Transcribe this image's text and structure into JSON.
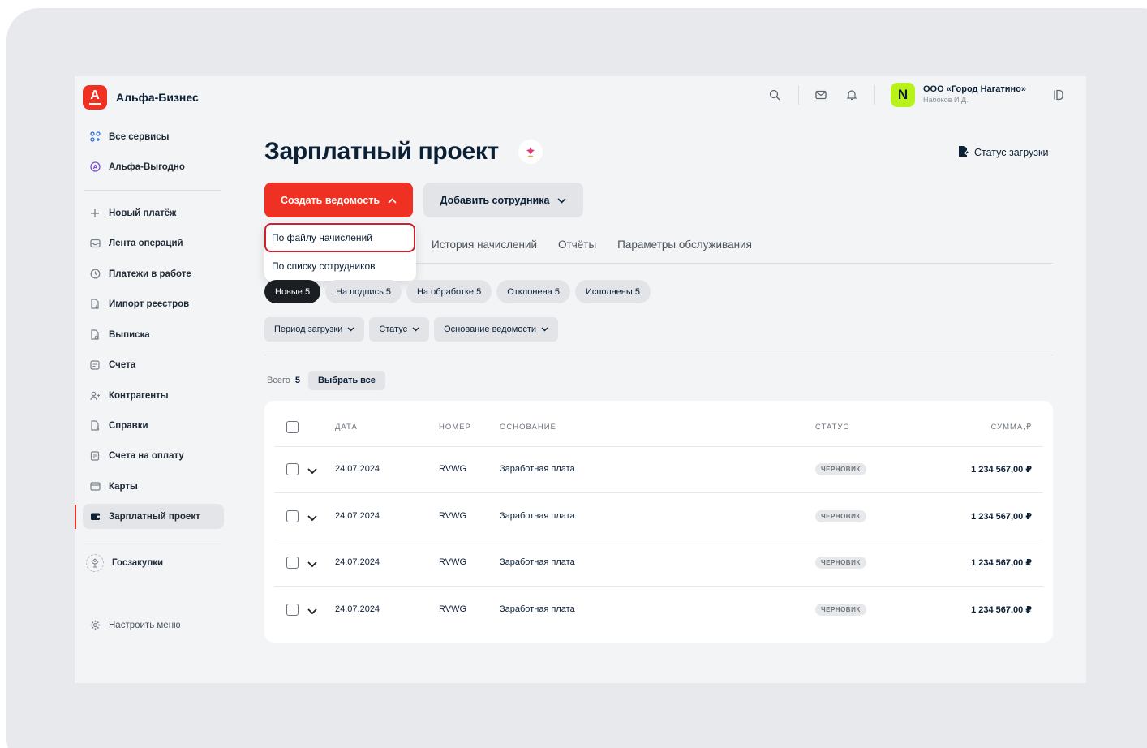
{
  "app": {
    "name": "Альфа-Бизнес",
    "logo_letter": "A"
  },
  "sidebar": {
    "items": [
      {
        "label": "Все сервисы",
        "icon": "grid-icon"
      },
      {
        "label": "Альфа-Выгодно",
        "icon": "alfa-circle-icon"
      },
      {
        "label": "Новый платёж",
        "icon": "plus-icon"
      },
      {
        "label": "Лента операций",
        "icon": "inbox-icon"
      },
      {
        "label": "Платежи в работе",
        "icon": "clock-icon"
      },
      {
        "label": "Импорт реестров",
        "icon": "doc-import-icon"
      },
      {
        "label": "Выписка",
        "icon": "doc-statement-icon"
      },
      {
        "label": "Счета",
        "icon": "accounts-icon"
      },
      {
        "label": "Контрагенты",
        "icon": "users-icon"
      },
      {
        "label": "Справки",
        "icon": "doc-info-icon"
      },
      {
        "label": "Счета на оплату",
        "icon": "invoice-icon"
      },
      {
        "label": "Карты",
        "icon": "card-icon"
      },
      {
        "label": "Зарплатный проект",
        "icon": "wallet-icon"
      },
      {
        "label": "Госзакупки",
        "icon": "emblem-icon"
      }
    ],
    "settings_label": "Настроить меню"
  },
  "header": {
    "org_name": "ООО «Город Нагатино»",
    "org_user": "Набоков И.Д.",
    "org_avatar": "N"
  },
  "main": {
    "title": "Зарплатный проект",
    "status_upload": "Статус загрузки",
    "create_button": "Создать ведомость",
    "add_employee_button": "Добавить сотрудника",
    "dropdown": [
      "По файлу начислений",
      "По списку сотрудников"
    ],
    "tabs": [
      "История начислений",
      "Отчёты",
      "Параметры обслуживания"
    ],
    "chips": [
      "Новые 5",
      "На подпись 5",
      "На обработке 5",
      "Отклонена 5",
      "Исполнены 5"
    ],
    "filters": [
      "Период загрузки",
      "Статус",
      "Основание ведомости"
    ],
    "total_label": "Всего",
    "total_count": "5",
    "select_all": "Выбрать все"
  },
  "table": {
    "columns": [
      "ДАТА",
      "НОМЕР",
      "ОСНОВАНИЕ",
      "СТАТУС",
      "СУММА,₽"
    ],
    "rows": [
      {
        "date": "24.07.2024",
        "number": "RVWG",
        "basis": "Заработная плата",
        "status": "ЧЕРНОВИК",
        "sum": "1 234 567,00 ₽"
      },
      {
        "date": "24.07.2024",
        "number": "RVWG",
        "basis": "Заработная плата",
        "status": "ЧЕРНОВИК",
        "sum": "1 234 567,00 ₽"
      },
      {
        "date": "24.07.2024",
        "number": "RVWG",
        "basis": "Заработная плата",
        "status": "ЧЕРНОВИК",
        "sum": "1 234 567,00 ₽"
      },
      {
        "date": "24.07.2024",
        "number": "RVWG",
        "basis": "Заработная плата",
        "status": "ЧЕРНОВИК",
        "sum": "1 234 567,00 ₽"
      }
    ]
  },
  "colors": {
    "accent": "#ef3124",
    "org_avatar": "#b9f21b",
    "chip_active": "#1b1e22"
  }
}
